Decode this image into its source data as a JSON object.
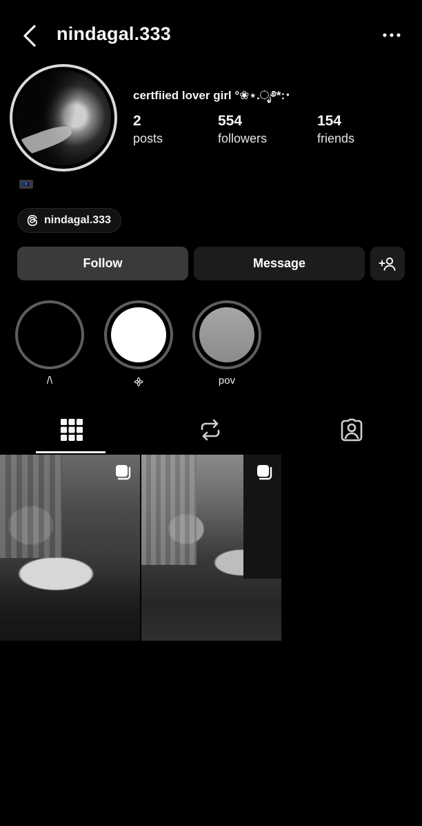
{
  "header": {
    "username": "nindagal.333"
  },
  "profile": {
    "bio": "certfiied lover girl °❀⋆.ೃ࿔*:･",
    "flag_label": "🇬🇺",
    "stats": [
      {
        "value": "2",
        "label": "posts"
      },
      {
        "value": "554",
        "label": "followers"
      },
      {
        "value": "154",
        "label": "friends"
      }
    ],
    "threads_handle": "nindagal.333"
  },
  "actions": {
    "follow": "Follow",
    "message": "Message"
  },
  "highlights": [
    {
      "label": "/\\",
      "fill": "#000000"
    },
    {
      "label": "᯽",
      "fill": "#ffffff"
    },
    {
      "label": "pov",
      "fill": "#9a9a9a"
    }
  ],
  "tabs": [
    {
      "name": "grid-icon",
      "active": true
    },
    {
      "name": "reposts-icon",
      "active": false
    },
    {
      "name": "tagged-icon",
      "active": false
    }
  ],
  "posts": [
    {
      "type": "carousel"
    },
    {
      "type": "carousel"
    }
  ],
  "colors": {
    "background": "#000000",
    "follow_button": "#3a3a3a",
    "secondary_button": "#1c1c1c",
    "text": "#f5f5f5"
  }
}
